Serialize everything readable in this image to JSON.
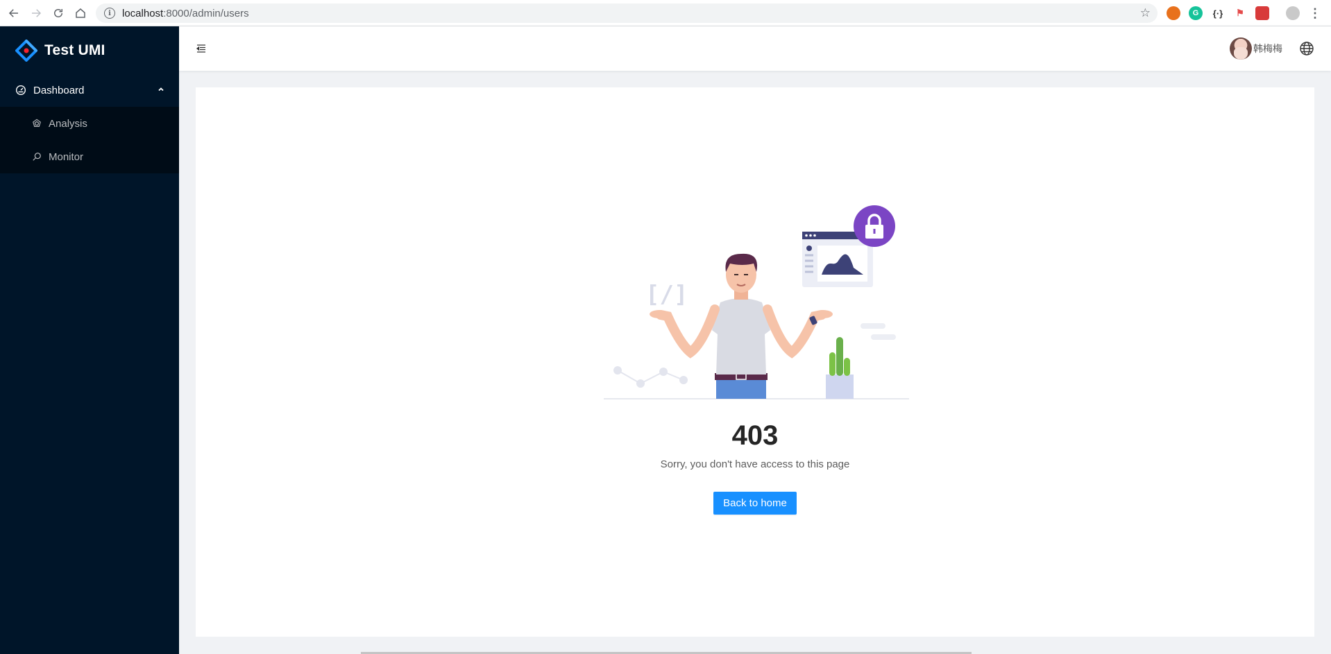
{
  "browser": {
    "url_host": "localhost",
    "url_path": ":8000/admin/users"
  },
  "sidebar": {
    "app_title": "Test UMI",
    "menu": {
      "label": "Dashboard",
      "items": [
        {
          "label": "Analysis",
          "icon": "radar-icon"
        },
        {
          "label": "Monitor",
          "icon": "monitor-icon"
        }
      ]
    }
  },
  "header": {
    "user_name": "韩梅梅"
  },
  "result": {
    "status_code": "403",
    "message": "Sorry, you don't have access to this page",
    "button_label": "Back to home"
  },
  "colors": {
    "sidebar_bg": "#001529",
    "submenu_bg": "#000c17",
    "primary": "#1890ff",
    "lock_badge": "#7b45c4"
  }
}
